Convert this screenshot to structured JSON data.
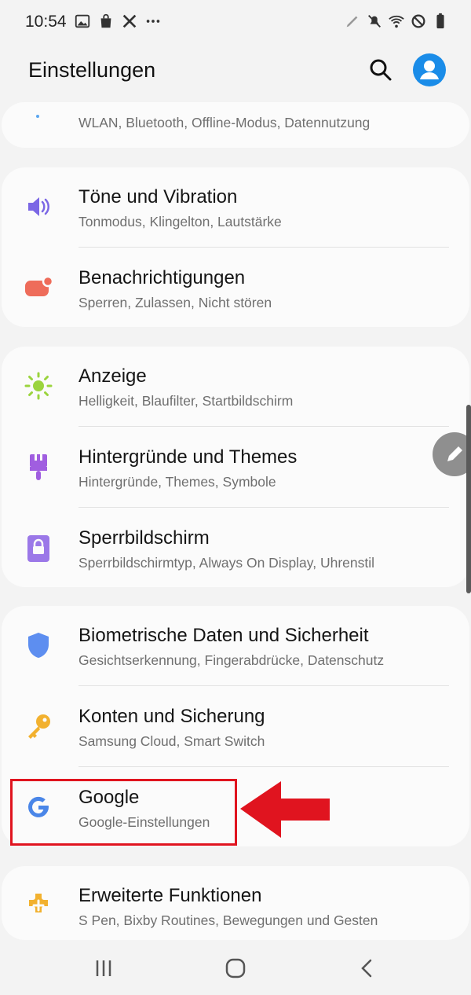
{
  "status_bar": {
    "time": "10:54",
    "left_icons": [
      "image-icon",
      "shopping-bag-icon",
      "tools-icon",
      "more-dots-icon"
    ],
    "right_icons": [
      "pen-icon",
      "mute-icon",
      "wifi-icon",
      "do-not-disturb-icon",
      "battery-icon"
    ]
  },
  "app_bar": {
    "title": "Einstellungen",
    "search_icon": "search-icon",
    "account_icon": "account-icon",
    "accent_color": "#1a8ce8"
  },
  "settings": {
    "partial_top": {
      "subtitle": "WLAN, Bluetooth, Offline-Modus, Datennutzung"
    },
    "group1": [
      {
        "title": "Töne und Vibration",
        "subtitle": "Tonmodus, Klingelton, Lautstärke",
        "icon": "speaker-icon",
        "color": "#7b67e5"
      },
      {
        "title": "Benachrichtigungen",
        "subtitle": "Sperren, Zulassen, Nicht stören",
        "icon": "notification-icon",
        "color": "#ee6c5a"
      }
    ],
    "group2": [
      {
        "title": "Anzeige",
        "subtitle": "Helligkeit, Blaufilter, Startbildschirm",
        "icon": "brightness-icon",
        "color": "#9bd43e"
      },
      {
        "title": "Hintergründe und Themes",
        "subtitle": "Hintergründe, Themes, Symbole",
        "icon": "paint-brush-icon",
        "color": "#a05ee0"
      },
      {
        "title": "Sperrbildschirm",
        "subtitle": "Sperrbildschirmtyp, Always On Display, Uhrenstil",
        "icon": "lock-icon",
        "color": "#9b78e8"
      }
    ],
    "group3": [
      {
        "title": "Biometrische Daten und Sicherheit",
        "subtitle": "Gesichtserkennung, Fingerabdrücke, Datenschutz",
        "icon": "shield-icon",
        "color": "#5d8ef0"
      },
      {
        "title": "Konten und Sicherung",
        "subtitle": "Samsung Cloud, Smart Switch",
        "icon": "key-icon",
        "color": "#f2b12f"
      },
      {
        "title": "Google",
        "subtitle": "Google-Einstellungen",
        "icon": "google-icon",
        "color": "#4a86e8"
      }
    ],
    "group4": [
      {
        "title": "Erweiterte Funktionen",
        "subtitle": "S Pen, Bixby Routines, Bewegungen und Gesten",
        "icon": "puzzle-plus-icon",
        "color": "#f2b12f"
      }
    ]
  },
  "annotation": {
    "highlight_color": "#e0141f",
    "target": "Google"
  },
  "nav_bar": {
    "icons": [
      "recent-apps-icon",
      "home-icon",
      "back-icon"
    ]
  }
}
